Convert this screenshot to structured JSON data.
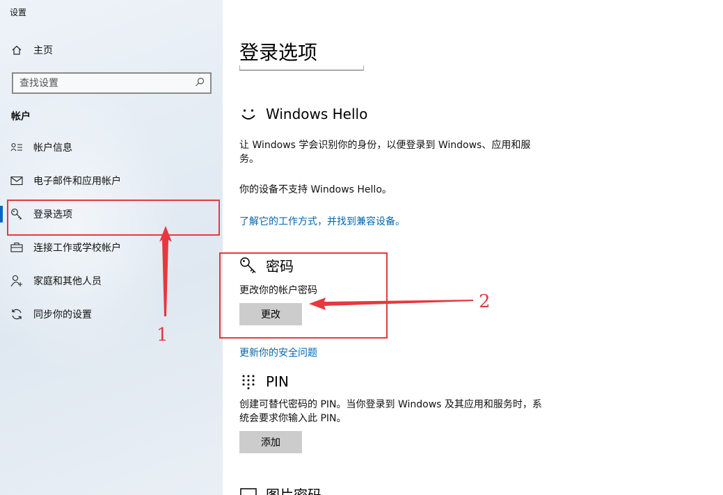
{
  "app": {
    "title": "设置"
  },
  "sidebar": {
    "home_label": "主页",
    "search_placeholder": "查找设置",
    "section_label": "帐户",
    "items": [
      {
        "label": "帐户信息",
        "icon": "account-info-icon"
      },
      {
        "label": "电子邮件和应用帐户",
        "icon": "mail-icon"
      },
      {
        "label": "登录选项",
        "icon": "key-icon",
        "selected": true
      },
      {
        "label": "连接工作或学校帐户",
        "icon": "briefcase-icon"
      },
      {
        "label": "家庭和其他人员",
        "icon": "person-add-icon"
      },
      {
        "label": "同步你的设置",
        "icon": "sync-icon"
      }
    ]
  },
  "main": {
    "title": "登录选项",
    "hello": {
      "title": "Windows Hello",
      "desc": "让 Windows 学会识别你的身份，以便登录到 Windows、应用和服务。",
      "status": "你的设备不支持 Windows Hello。",
      "link": "了解它的工作方式，并找到兼容设备。"
    },
    "password": {
      "title": "密码",
      "desc": "更改你的帐户密码",
      "button": "更改",
      "link": "更新你的安全问题"
    },
    "pin": {
      "title": "PIN",
      "desc": "创建可替代密码的 PIN。当你登录到 Windows 及其应用和服务时，系统会要求你输入此 PIN。",
      "button": "添加"
    },
    "picture_password": {
      "title": "图片密码"
    }
  },
  "annotations": {
    "marker1": "1",
    "marker2": "2",
    "color": "#e6383f"
  },
  "colors": {
    "accent": "#0067c0",
    "link": "#0066b4",
    "button_bg": "#cccccc"
  }
}
